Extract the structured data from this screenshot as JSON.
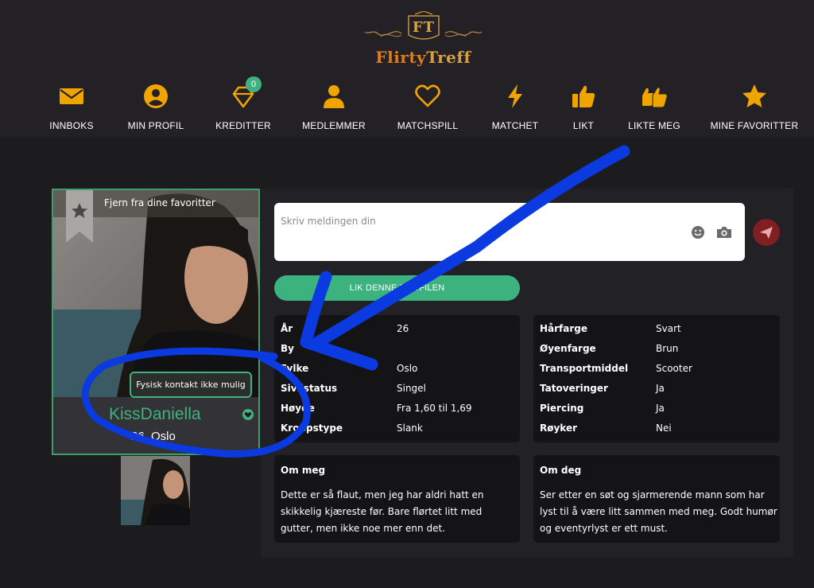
{
  "brand": {
    "badge": "FT",
    "name_part1": "Flirty",
    "name_part2": "Treff"
  },
  "nav": [
    {
      "label": "INNBOKS",
      "icon": "envelope-icon"
    },
    {
      "label": "MIN PROFIL",
      "icon": "user-circle-icon"
    },
    {
      "label": "KREDITTER",
      "icon": "diamond-icon",
      "badge": "0"
    },
    {
      "label": "MEDLEMMER",
      "icon": "person-icon"
    },
    {
      "label": "MATCHSPILL",
      "icon": "heart-icon"
    },
    {
      "label": "MATCHET",
      "icon": "lightning-icon"
    },
    {
      "label": "LIKT",
      "icon": "thumbs-up-icon"
    },
    {
      "label": "LIKTE MEG",
      "icon": "double-thumbs-up-icon"
    },
    {
      "label": "MINE FAVORITTER",
      "icon": "star-icon"
    }
  ],
  "colors": {
    "accent": "#f0a400",
    "green": "#3cb37e",
    "send": "#7f1f22"
  },
  "profile": {
    "favorite_label": "Fjern fra dine favoritter",
    "username": "KissDaniella",
    "age_city": "26, Oslo",
    "tooltip": "Fysisk kontakt ikke mulig"
  },
  "message": {
    "placeholder": "Skriv meldingen din"
  },
  "like_button": "LIK DENNE PROFILEN",
  "details_left": [
    {
      "key": "År",
      "value": "26"
    },
    {
      "key": "By",
      "value": ""
    },
    {
      "key": "Fylke",
      "value": "Oslo"
    },
    {
      "key": "Sivilstatus",
      "value": "Singel"
    },
    {
      "key": "Høyde",
      "value": "Fra 1,60 til 1,69"
    },
    {
      "key": "Kroppstype",
      "value": "Slank"
    }
  ],
  "details_right": [
    {
      "key": "Hårfarge",
      "value": "Svart"
    },
    {
      "key": "Øyenfarge",
      "value": "Brun"
    },
    {
      "key": "Transportmiddel",
      "value": "Scooter"
    },
    {
      "key": "Tatoveringer",
      "value": "Ja"
    },
    {
      "key": "Piercing",
      "value": "Ja"
    },
    {
      "key": "Røyker",
      "value": "Nei"
    }
  ],
  "about_me": {
    "title": "Om meg",
    "text": "Dette er så flaut, men jeg har aldri hatt en skikkelig kjæreste før. Bare flørtet litt med gutter, men ikke noe mer enn det."
  },
  "about_you": {
    "title": "Om deg",
    "text": "Ser etter en søt og sjarmerende mann som har lyst til å være litt sammen med meg. Godt humør og eventyrlyst er ett must."
  }
}
